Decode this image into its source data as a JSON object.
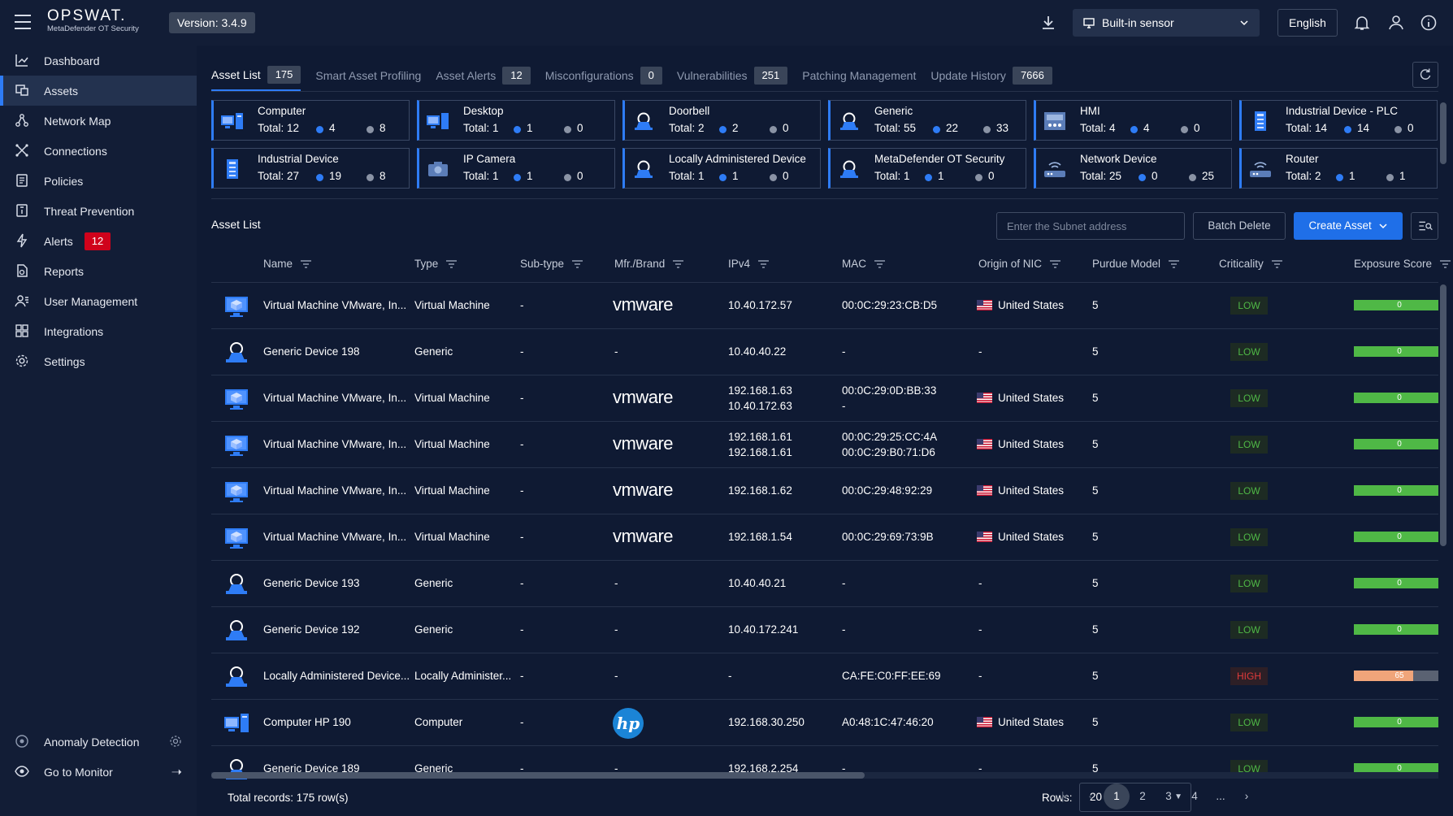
{
  "header": {
    "brand": "OPSWAT.",
    "product": "MetaDefender OT Security",
    "version": "Version: 3.4.9",
    "sensor": "Built-in sensor",
    "language": "English"
  },
  "sidebar": {
    "items": [
      {
        "label": "Dashboard",
        "icon": "chart-line-icon"
      },
      {
        "label": "Assets",
        "icon": "assets-icon"
      },
      {
        "label": "Network Map",
        "icon": "network-map-icon"
      },
      {
        "label": "Connections",
        "icon": "connections-icon"
      },
      {
        "label": "Policies",
        "icon": "policies-icon"
      },
      {
        "label": "Threat Prevention",
        "icon": "threat-prevention-icon"
      },
      {
        "label": "Alerts",
        "icon": "alerts-bolt-icon",
        "badge": "12"
      },
      {
        "label": "Reports",
        "icon": "reports-icon"
      },
      {
        "label": "User Management",
        "icon": "user-management-icon"
      },
      {
        "label": "Integrations",
        "icon": "integrations-icon"
      },
      {
        "label": "Settings",
        "icon": "gear-icon"
      }
    ],
    "anomaly_detection": "Anomaly Detection",
    "go_to_monitor": "Go to Monitor"
  },
  "tabs": [
    {
      "label": "Asset List",
      "count": "175"
    },
    {
      "label": "Smart Asset Profiling",
      "count": ""
    },
    {
      "label": "Asset Alerts",
      "count": "12"
    },
    {
      "label": "Misconfigurations",
      "count": "0"
    },
    {
      "label": "Vulnerabilities",
      "count": "251"
    },
    {
      "label": "Patching Management",
      "count": ""
    },
    {
      "label": "Update History",
      "count": "7666"
    }
  ],
  "cards": [
    {
      "title": "Computer",
      "total": "Total: 12",
      "blue": "4",
      "gray": "8",
      "icon": "computer-icon"
    },
    {
      "title": "Desktop",
      "total": "Total: 1",
      "blue": "1",
      "gray": "0",
      "icon": "desktop-icon"
    },
    {
      "title": "Doorbell",
      "total": "Total: 2",
      "blue": "2",
      "gray": "0",
      "icon": "generic-device-icon"
    },
    {
      "title": "Generic",
      "total": "Total: 55",
      "blue": "22",
      "gray": "33",
      "icon": "generic-device-icon"
    },
    {
      "title": "HMI",
      "total": "Total: 4",
      "blue": "4",
      "gray": "0",
      "icon": "hmi-icon"
    },
    {
      "title": "Industrial Device - PLC",
      "total": "Total: 14",
      "blue": "14",
      "gray": "0",
      "icon": "plc-icon"
    },
    {
      "title": "Industrial Device",
      "total": "Total: 27",
      "blue": "19",
      "gray": "8",
      "icon": "plc-icon"
    },
    {
      "title": "IP Camera",
      "total": "Total: 1",
      "blue": "1",
      "gray": "0",
      "icon": "camera-icon"
    },
    {
      "title": "Locally Administered Device",
      "total": "Total: 1",
      "blue": "1",
      "gray": "0",
      "icon": "generic-device-icon"
    },
    {
      "title": "MetaDefender OT Security",
      "total": "Total: 1",
      "blue": "1",
      "gray": "0",
      "icon": "generic-device-icon"
    },
    {
      "title": "Network Device",
      "total": "Total: 25",
      "blue": "0",
      "gray": "25",
      "icon": "router-icon"
    },
    {
      "title": "Router",
      "total": "Total: 2",
      "blue": "1",
      "gray": "1",
      "icon": "router-icon"
    }
  ],
  "asset_list": {
    "title": "Asset List",
    "subnet_placeholder": "Enter the Subnet address",
    "batch_delete": "Batch Delete",
    "create_asset": "Create Asset",
    "columns": [
      "Name",
      "Type",
      "Sub-type",
      "Mfr./Brand",
      "IPv4",
      "MAC",
      "Origin of NIC",
      "Purdue Model",
      "Criticality",
      "Exposure Score"
    ],
    "rows": [
      {
        "icon": "virtual-machine-icon",
        "name": "Virtual Machine VMware, In...",
        "type": "Virtual Machine",
        "subtype": "-",
        "brand": "vmware",
        "ipv4": [
          "10.40.172.57"
        ],
        "mac": [
          "00:0C:29:23:CB:D5"
        ],
        "origin": "United States",
        "purdue": "5",
        "criticality": "LOW",
        "score": "0",
        "score_fraction": 1.0
      },
      {
        "icon": "generic-device-icon",
        "name": "Generic Device 198",
        "type": "Generic",
        "subtype": "-",
        "brand": "-",
        "ipv4": [
          "10.40.40.22"
        ],
        "mac": [
          "-"
        ],
        "origin": "-",
        "purdue": "5",
        "criticality": "LOW",
        "score": "0",
        "score_fraction": 1.0
      },
      {
        "icon": "virtual-machine-icon",
        "name": "Virtual Machine VMware, In...",
        "type": "Virtual Machine",
        "subtype": "-",
        "brand": "vmware",
        "ipv4": [
          "192.168.1.63",
          "10.40.172.63"
        ],
        "mac": [
          "00:0C:29:0D:BB:33",
          "-"
        ],
        "origin": "United States",
        "purdue": "5",
        "criticality": "LOW",
        "score": "0",
        "score_fraction": 1.0
      },
      {
        "icon": "virtual-machine-icon",
        "name": "Virtual Machine VMware, In...",
        "type": "Virtual Machine",
        "subtype": "-",
        "brand": "vmware",
        "ipv4": [
          "192.168.1.61",
          "192.168.1.61"
        ],
        "mac": [
          "00:0C:29:25:CC:4A",
          "00:0C:29:B0:71:D6"
        ],
        "origin": "United States",
        "purdue": "5",
        "criticality": "LOW",
        "score": "0",
        "score_fraction": 1.0
      },
      {
        "icon": "virtual-machine-icon",
        "name": "Virtual Machine VMware, In...",
        "type": "Virtual Machine",
        "subtype": "-",
        "brand": "vmware",
        "ipv4": [
          "192.168.1.62"
        ],
        "mac": [
          "00:0C:29:48:92:29"
        ],
        "origin": "United States",
        "purdue": "5",
        "criticality": "LOW",
        "score": "0",
        "score_fraction": 1.0
      },
      {
        "icon": "virtual-machine-icon",
        "name": "Virtual Machine VMware, In...",
        "type": "Virtual Machine",
        "subtype": "-",
        "brand": "vmware",
        "ipv4": [
          "192.168.1.54"
        ],
        "mac": [
          "00:0C:29:69:73:9B"
        ],
        "origin": "United States",
        "purdue": "5",
        "criticality": "LOW",
        "score": "0",
        "score_fraction": 1.0
      },
      {
        "icon": "generic-device-icon",
        "name": "Generic Device 193",
        "type": "Generic",
        "subtype": "-",
        "brand": "-",
        "ipv4": [
          "10.40.40.21"
        ],
        "mac": [
          "-"
        ],
        "origin": "-",
        "purdue": "5",
        "criticality": "LOW",
        "score": "0",
        "score_fraction": 1.0
      },
      {
        "icon": "generic-device-icon",
        "name": "Generic Device 192",
        "type": "Generic",
        "subtype": "-",
        "brand": "-",
        "ipv4": [
          "10.40.172.241"
        ],
        "mac": [
          "-"
        ],
        "origin": "-",
        "purdue": "5",
        "criticality": "LOW",
        "score": "0",
        "score_fraction": 1.0
      },
      {
        "icon": "generic-device-icon",
        "name": "Locally Administered Device...",
        "type": "Locally Administer...",
        "subtype": "-",
        "brand": "-",
        "ipv4": [
          "-"
        ],
        "mac": [
          "CA:FE:C0:FF:EE:69"
        ],
        "origin": "-",
        "purdue": "5",
        "criticality": "HIGH",
        "score": "65",
        "score_fraction": 0.65
      },
      {
        "icon": "computer-icon",
        "name": "Computer HP 190",
        "type": "Computer",
        "subtype": "-",
        "brand": "hp",
        "ipv4": [
          "192.168.30.250"
        ],
        "mac": [
          "A0:48:1C:47:46:20"
        ],
        "origin": "United States",
        "purdue": "5",
        "criticality": "LOW",
        "score": "0",
        "score_fraction": 1.0
      },
      {
        "icon": "generic-device-icon",
        "name": "Generic Device 189",
        "type": "Generic",
        "subtype": "-",
        "brand": "-",
        "ipv4": [
          "192.168.2.254"
        ],
        "mac": [
          "-"
        ],
        "origin": "-",
        "purdue": "5",
        "criticality": "LOW",
        "score": "0",
        "score_fraction": 1.0
      }
    ]
  },
  "footer": {
    "total": "Total records: 175 row(s)",
    "rows_label": "Rows:",
    "rows_value": "20",
    "pages": [
      "1",
      "2",
      "3",
      "4",
      "..."
    ]
  },
  "colors": {
    "accent": "#2e7cf6",
    "low": "#4fb846",
    "high": "#e03b3b",
    "score_low": "#4fb846",
    "score_high": "#f0a57a"
  }
}
